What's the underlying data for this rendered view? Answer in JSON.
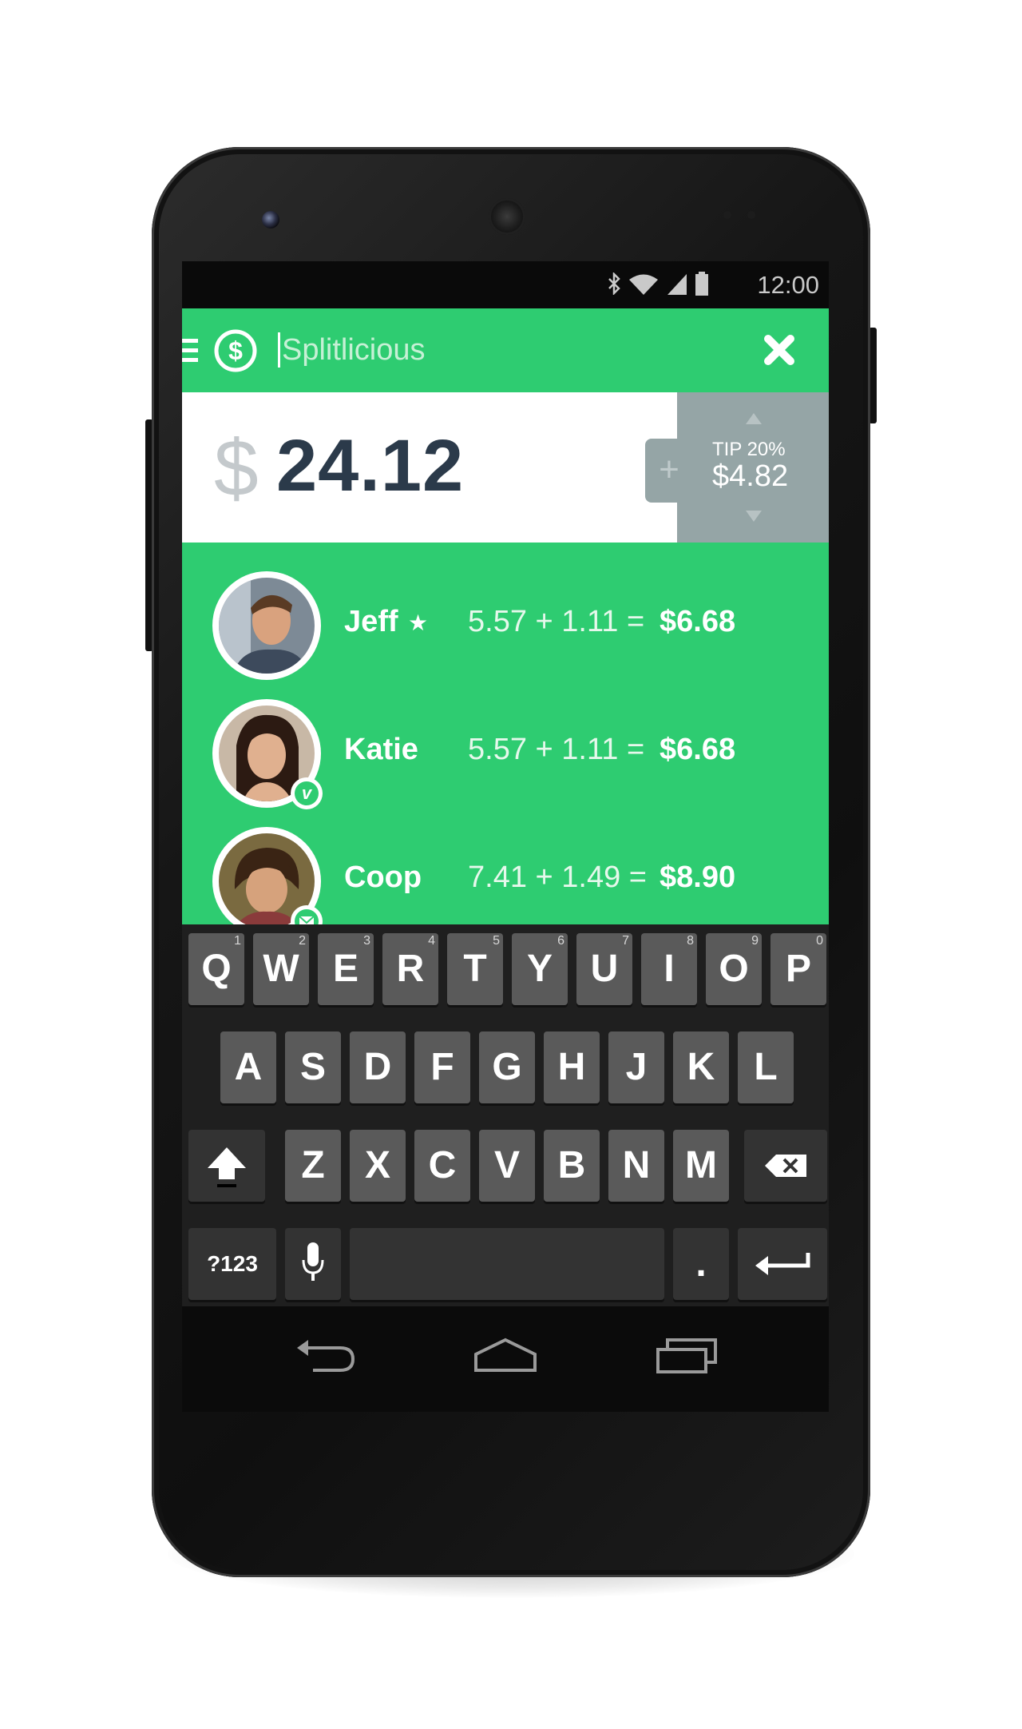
{
  "status_bar": {
    "time": "12:00",
    "icons": [
      "bluetooth-icon",
      "wifi-icon",
      "signal-icon",
      "battery-icon"
    ]
  },
  "app_bar": {
    "menu_icon": "hamburger-icon",
    "logo_icon": "dollar-circle-icon",
    "title": "Splitlicious",
    "close_icon": "close-icon"
  },
  "bill": {
    "currency_symbol": "$",
    "amount": "24.12"
  },
  "tip": {
    "add_symbol": "+",
    "label": "TIP 20%",
    "value": "$4.82"
  },
  "people": [
    {
      "name": "Jeff",
      "starred": true,
      "share": "5.57",
      "tip": "1.11",
      "total": "$6.68",
      "badge": ""
    },
    {
      "name": "Katie",
      "starred": false,
      "share": "5.57",
      "tip": "1.11",
      "total": "$6.68",
      "badge": "v"
    },
    {
      "name": "Coop",
      "starred": false,
      "share": "7.41",
      "tip": "1.49",
      "total": "$8.90",
      "badge": "mail-icon"
    }
  ],
  "keyboard": {
    "row1": [
      {
        "k": "Q",
        "alt": "1"
      },
      {
        "k": "W",
        "alt": "2"
      },
      {
        "k": "E",
        "alt": "3"
      },
      {
        "k": "R",
        "alt": "4"
      },
      {
        "k": "T",
        "alt": "5"
      },
      {
        "k": "Y",
        "alt": "6"
      },
      {
        "k": "U",
        "alt": "7"
      },
      {
        "k": "I",
        "alt": "8"
      },
      {
        "k": "O",
        "alt": "9"
      },
      {
        "k": "P",
        "alt": "0"
      }
    ],
    "row2": [
      "A",
      "S",
      "D",
      "F",
      "G",
      "H",
      "J",
      "K",
      "L"
    ],
    "row3": [
      "Z",
      "X",
      "C",
      "V",
      "B",
      "N",
      "M"
    ],
    "symbols_label": "?123",
    "period_label": ".",
    "shift_icon": "shift-icon",
    "backspace_icon": "backspace-icon",
    "mic_icon": "mic-icon",
    "enter_icon": "enter-icon"
  },
  "nav_bar": {
    "icons": [
      "back-icon",
      "home-icon",
      "recents-icon"
    ]
  },
  "colors": {
    "brand_green": "#2ecc71",
    "tip_gray": "#95a5a6",
    "amount_text": "#2b3a4a"
  }
}
